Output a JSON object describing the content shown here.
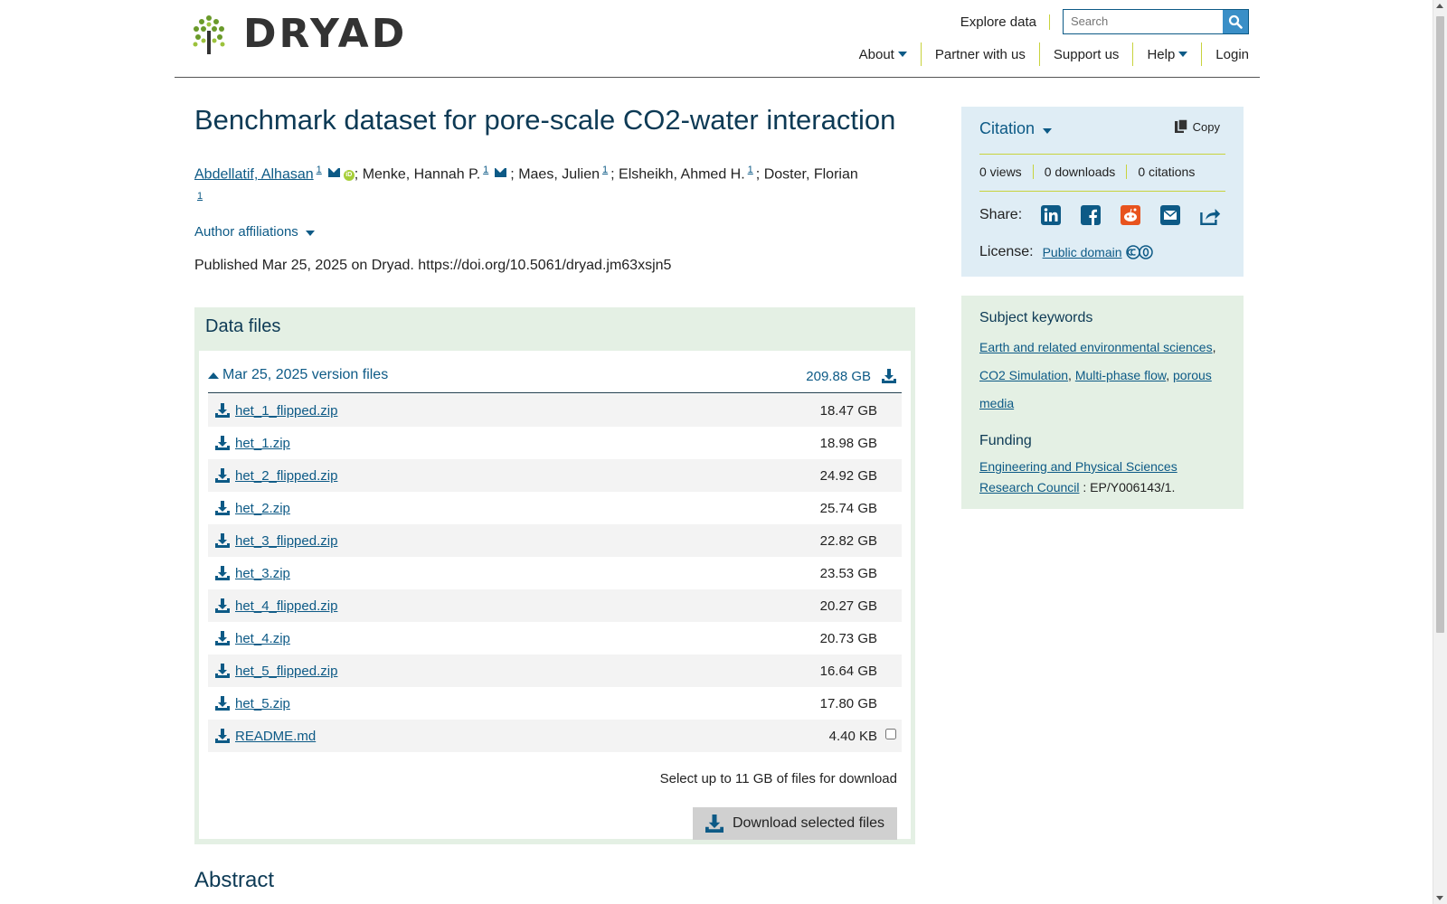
{
  "header": {
    "logo_text": "DRYAD",
    "explore": "Explore data",
    "search_placeholder": "Search",
    "nav": [
      "About",
      "Partner with us",
      "Support us",
      "Help",
      "Login"
    ]
  },
  "dataset": {
    "title": "Benchmark dataset for pore-scale CO2-water interaction",
    "authors": [
      {
        "name": "Abdellatif, Alhasan",
        "sup": "1"
      },
      {
        "name": "Menke, Hannah P.",
        "sup": "1"
      },
      {
        "name": "Maes, Julien",
        "sup": "1"
      },
      {
        "name": "Elsheikh, Ahmed H.",
        "sup": "1"
      },
      {
        "name": "Doster, Florian",
        "sup": "1"
      }
    ],
    "sep": ";",
    "affiliations_label": "Author affiliations",
    "published": "Published Mar 25, 2025 on Dryad. https://doi.org/10.5061/dryad.jm63xsjn5"
  },
  "data_files": {
    "heading": "Data files",
    "version_label": "Mar 25, 2025 version files",
    "version_size": "209.88 GB",
    "files": [
      {
        "name": "het_1_flipped.zip",
        "size": "18.47 GB"
      },
      {
        "name": "het_1.zip",
        "size": "18.98 GB"
      },
      {
        "name": "het_2_flipped.zip",
        "size": "24.92 GB"
      },
      {
        "name": "het_2.zip",
        "size": "25.74 GB"
      },
      {
        "name": "het_3_flipped.zip",
        "size": "22.82 GB"
      },
      {
        "name": "het_3.zip",
        "size": "23.53 GB"
      },
      {
        "name": "het_4_flipped.zip",
        "size": "20.27 GB"
      },
      {
        "name": "het_4.zip",
        "size": "20.73 GB"
      },
      {
        "name": "het_5_flipped.zip",
        "size": "16.64 GB"
      },
      {
        "name": "het_5.zip",
        "size": "17.80 GB"
      },
      {
        "name": "README.md",
        "size": "4.40 KB"
      }
    ],
    "select_note": "Select up to 11 GB of files for download",
    "download_button": "Download selected files"
  },
  "abstract_heading": "Abstract",
  "sidebar": {
    "citation_label": "Citation",
    "copy_label": "Copy",
    "stats": [
      "0 views",
      "0 downloads",
      "0 citations"
    ],
    "share_label": "Share:",
    "license_label": "License:",
    "license_value": "Public domain",
    "keywords_title": "Subject keywords",
    "keywords": [
      "Earth and related environmental sciences",
      "CO2 Simulation",
      "Multi-phase flow",
      "porous media"
    ],
    "funding_title": "Funding",
    "funder": "Engineering and Physical Sciences Research Council",
    "grant": ": EP/Y006143/1."
  },
  "colors": {
    "accent": "#0d5a86",
    "green_panel": "#e4f0e4",
    "blue_panel": "#dfedf5",
    "rule": "#c8d33d"
  }
}
